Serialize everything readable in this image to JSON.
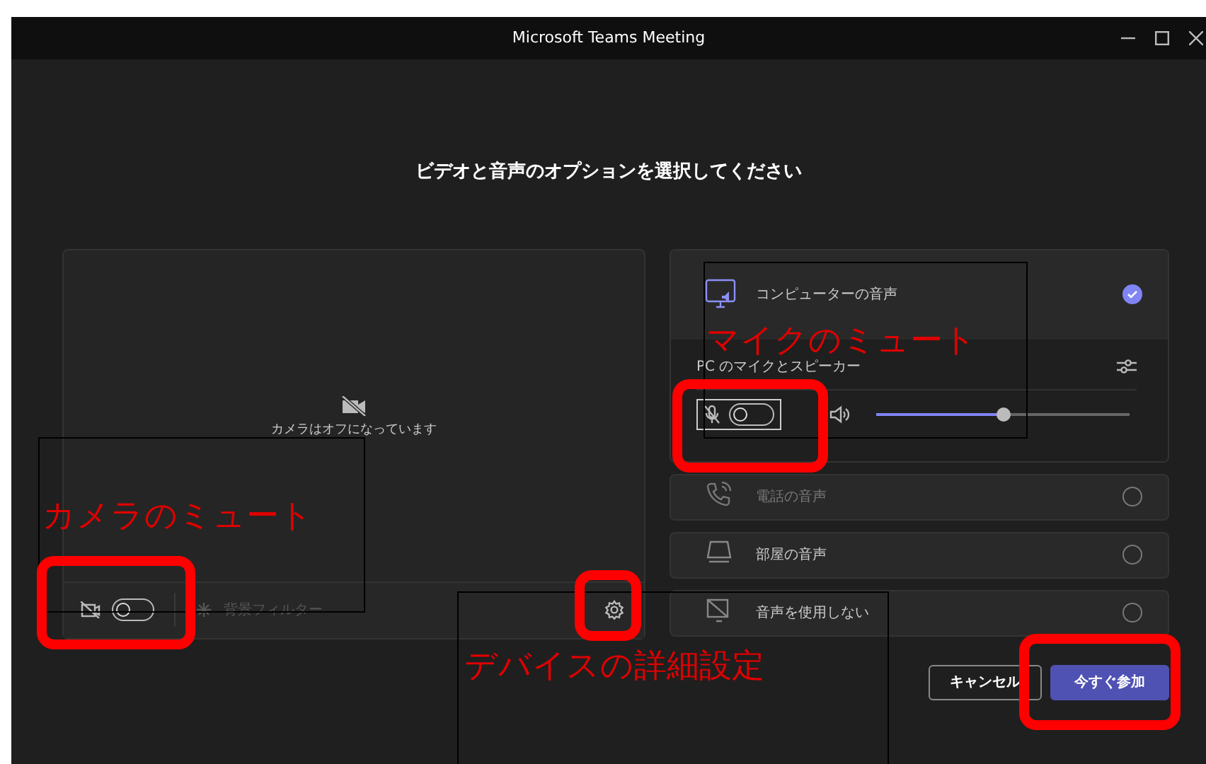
{
  "window": {
    "title": "Microsoft Teams Meeting"
  },
  "heading": "ビデオと音声のオプションを選択してください",
  "video": {
    "camera_status": "カメラはオフになっています",
    "camera_on": false,
    "background_filter": "背景フィルター"
  },
  "computer_audio": {
    "device": "PC のマイクとスピーカー",
    "mic_on": false,
    "volume": {
      "level": 0.5
    }
  },
  "audio_options": [
    {
      "kind": "computer",
      "label": "コンピューターの音声",
      "selected": true,
      "disabled": false
    },
    {
      "kind": "phone",
      "label": "電話の音声",
      "selected": false,
      "disabled": true
    },
    {
      "kind": "room",
      "label": "部屋の音声",
      "selected": false,
      "disabled": false
    },
    {
      "kind": "none",
      "label": "音声を使用しない",
      "selected": false,
      "disabled": false
    }
  ],
  "buttons": [
    {
      "kind": "secondary",
      "label": "キャンセル"
    },
    {
      "kind": "primary",
      "label": "今すぐ参加"
    }
  ],
  "annotations": [
    {
      "text": "マイクのミュート"
    },
    {
      "text": "カメラのミュート"
    },
    {
      "text": "デバイスの詳細設定"
    }
  ]
}
